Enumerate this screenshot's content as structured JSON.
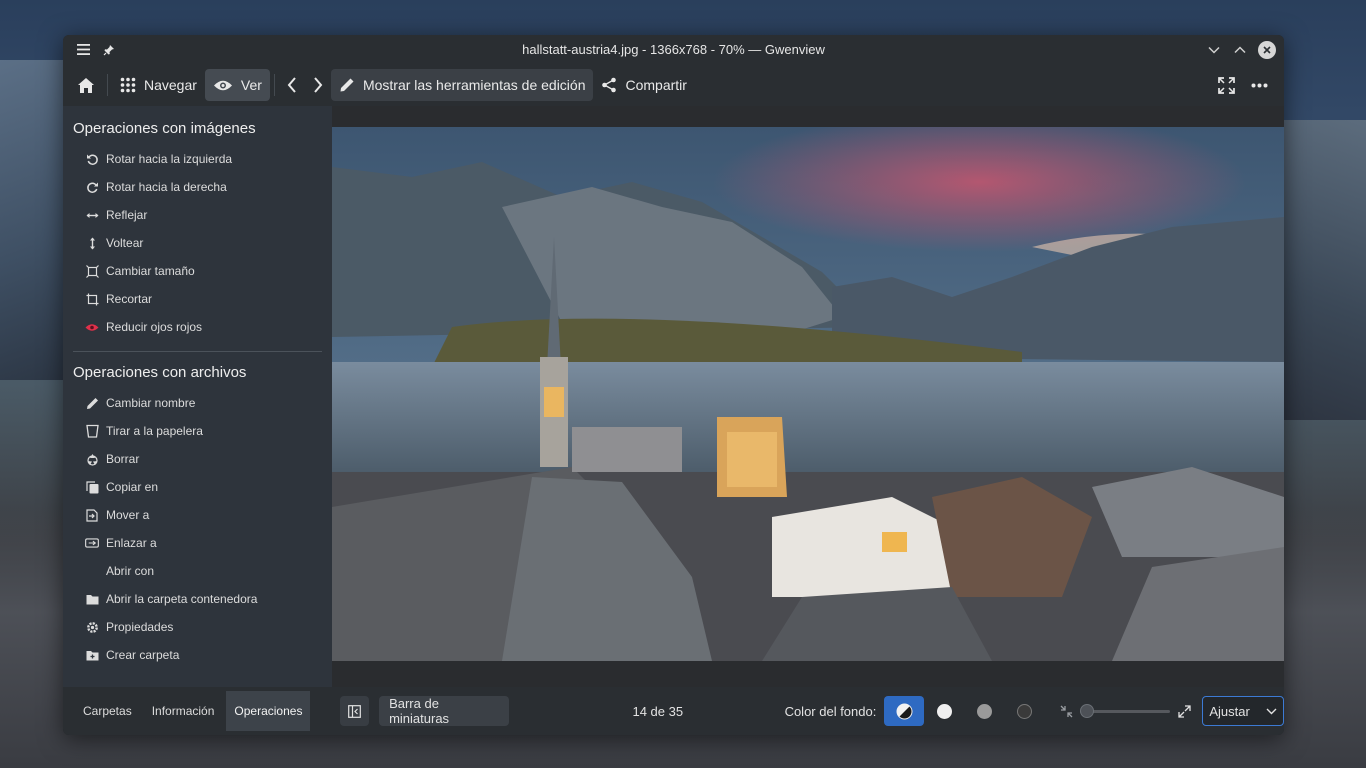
{
  "window": {
    "title": "hallstatt-austria4.jpg - 1366x768 - 70% — Gwenview"
  },
  "toolbar": {
    "browse_label": "Navegar",
    "view_label": "Ver",
    "edit_tools_label": "Mostrar las herramientas de edición",
    "share_label": "Compartir"
  },
  "sidebar": {
    "image_ops_title": "Operaciones con imágenes",
    "image_ops": [
      {
        "label": "Rotar hacia la izquierda",
        "icon": "rotate-left-icon"
      },
      {
        "label": "Rotar hacia la derecha",
        "icon": "rotate-right-icon"
      },
      {
        "label": "Reflejar",
        "icon": "mirror-icon"
      },
      {
        "label": "Voltear",
        "icon": "flip-icon"
      },
      {
        "label": "Cambiar tamaño",
        "icon": "resize-icon"
      },
      {
        "label": "Recortar",
        "icon": "crop-icon"
      },
      {
        "label": "Reducir ojos rojos",
        "icon": "red-eye-icon"
      }
    ],
    "file_ops_title": "Operaciones con archivos",
    "file_ops": [
      {
        "label": "Cambiar nombre",
        "icon": "rename-icon"
      },
      {
        "label": "Tirar a la papelera",
        "icon": "trash-icon"
      },
      {
        "label": "Borrar",
        "icon": "delete-icon"
      },
      {
        "label": "Copiar en",
        "icon": "copy-icon"
      },
      {
        "label": "Mover a",
        "icon": "move-icon"
      },
      {
        "label": "Enlazar a",
        "icon": "link-icon"
      },
      {
        "label": "Abrir con",
        "icon": ""
      },
      {
        "label": "Abrir la carpeta contenedora",
        "icon": "folder-icon"
      },
      {
        "label": "Propiedades",
        "icon": "properties-icon"
      },
      {
        "label": "Crear carpeta",
        "icon": "new-folder-icon"
      }
    ]
  },
  "bottom_tabs": {
    "folders": "Carpetas",
    "info": "Información",
    "operations": "Operaciones"
  },
  "statusbar": {
    "thumbnail_bar_label": "Barra de miniaturas",
    "counter": "14 de 35",
    "background_color_label": "Color del fondo:",
    "zoom_mode": "Ajustar"
  },
  "colors": {
    "accent": "#2e6ac2",
    "red_eye": "#e0304a"
  }
}
